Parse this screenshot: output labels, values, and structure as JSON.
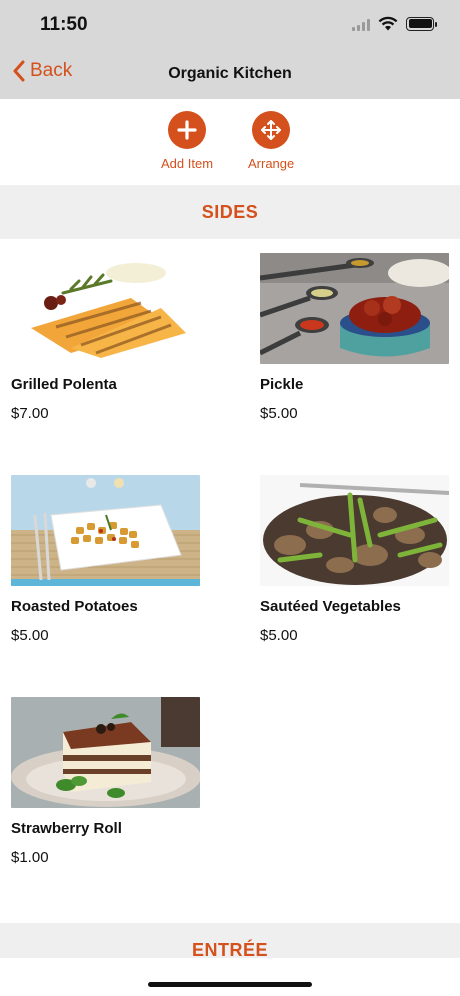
{
  "status": {
    "time": "11:50"
  },
  "nav": {
    "back_label": "Back",
    "title": "Organic Kitchen"
  },
  "toolbar": {
    "add_label": "Add Item",
    "arrange_label": "Arrange"
  },
  "sections": [
    {
      "title": "SIDES",
      "items": [
        {
          "name": "Grilled Polenta",
          "price": "$7.00"
        },
        {
          "name": "Pickle",
          "price": "$5.00"
        },
        {
          "name": "Roasted Potatoes",
          "price": "$5.00"
        },
        {
          "name": "Sautéed Vegetables",
          "price": "$5.00"
        },
        {
          "name": "Strawberry Roll",
          "price": "$1.00"
        }
      ]
    },
    {
      "title": "ENTRÉE"
    }
  ],
  "colors": {
    "accent": "#d4501c",
    "nav_bg": "#d8d8d8",
    "section_bg": "#efefef"
  }
}
